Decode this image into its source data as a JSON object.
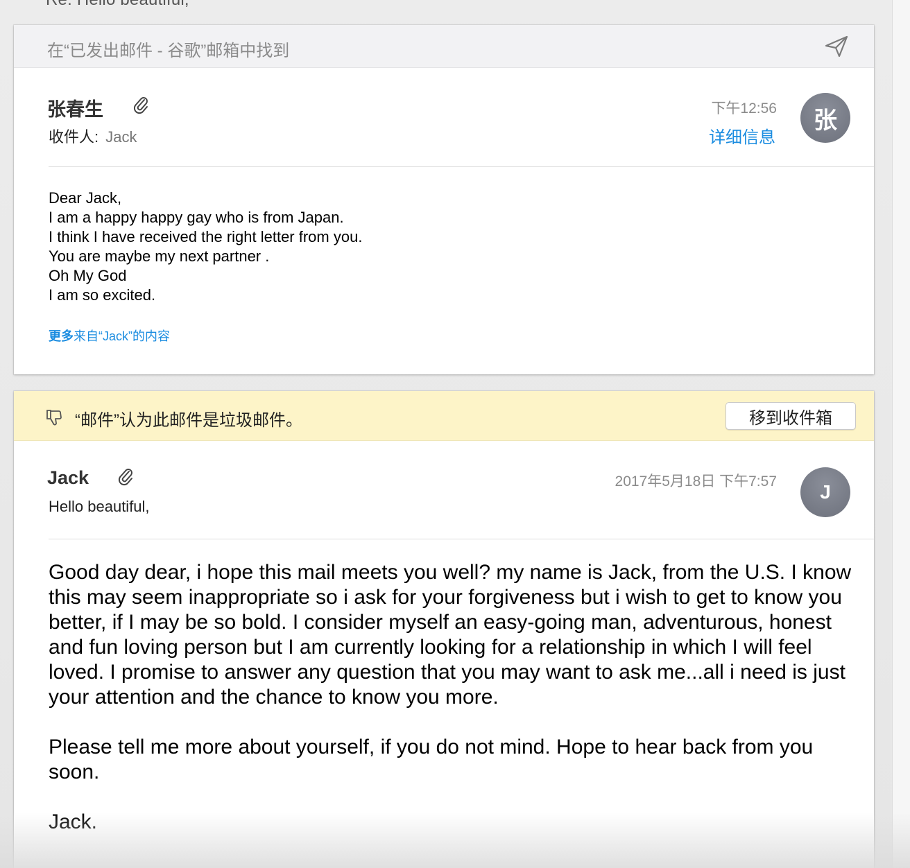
{
  "thread": {
    "subject_peek": "Re: Hello beautiful,"
  },
  "message1": {
    "found_in": "在“已发出邮件 - 谷歌”邮箱中找到",
    "sender": "张春生",
    "to_label": "收件人:",
    "to_value": "Jack",
    "time": "下午12:56",
    "details_link": "详细信息",
    "avatar_initial": "张",
    "body_lines": [
      "Dear Jack,",
      "I am a happy happy gay who is from Japan.",
      "I think I have received the right letter from you.",
      "You are maybe my next partner .",
      "Oh My God",
      "I am so excited."
    ],
    "more_from_prefix": "更多",
    "more_from_rest": "来自“Jack”的内容"
  },
  "message2": {
    "junk_notice": "“邮件”认为此邮件是垃圾邮件。",
    "move_button": "移到收件箱",
    "sender": "Jack",
    "subject": "Hello beautiful,",
    "time": "2017年5月18日 下午7:57",
    "avatar_initial": "J",
    "body_paragraphs": [
      "Good day dear, i hope this mail meets you well? my name is Jack, from the U.S. I know this may seem inappropriate so i ask for your forgiveness but i wish to get to know you better, if I may be so bold. I consider myself an easy-going man, adventurous, honest and fun loving person but I am currently looking for a relationship in which I will feel loved. I promise to answer any question that you may want to ask me...all i need is just your attention and the chance to know you more.",
      "Please tell me more about yourself, if you do not mind. Hope to hear back from you soon.",
      "Jack."
    ]
  },
  "icons": {
    "send": "send-icon",
    "attachment": "paperclip-icon",
    "junk": "thumbs-down-icon"
  },
  "colors": {
    "link_blue": "#1a8ce0",
    "junk_bar": "#fdf4c8",
    "avatar_gray": "#7a7e89"
  }
}
